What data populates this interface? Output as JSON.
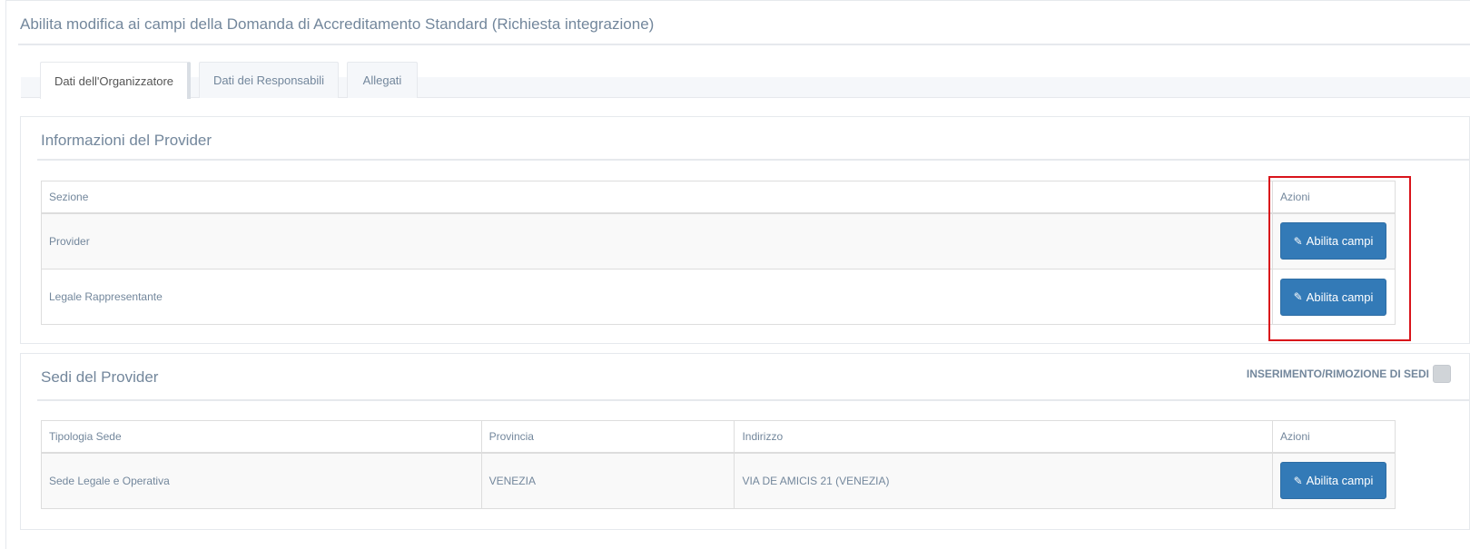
{
  "page": {
    "title": "Abilita modifica ai campi della Domanda di Accreditamento Standard (Richiesta integrazione)"
  },
  "tabs": [
    {
      "label": "Dati dell'Organizzatore",
      "active": true
    },
    {
      "label": "Dati dei Responsabili",
      "active": false
    },
    {
      "label": "Allegati",
      "active": false
    }
  ],
  "provider_info": {
    "title": "Informazioni del Provider",
    "headers": {
      "section": "Sezione",
      "actions": "Azioni"
    },
    "rows": [
      {
        "section": "Provider",
        "action_label": "Abilita campi"
      },
      {
        "section": "Legale Rappresentante",
        "action_label": "Abilita campi"
      }
    ]
  },
  "sedi": {
    "title": "Sedi del Provider",
    "toggle_label": "INSERIMENTO/RIMOZIONE DI SEDI",
    "headers": {
      "tipologia": "Tipologia Sede",
      "provincia": "Provincia",
      "indirizzo": "Indirizzo",
      "actions": "Azioni"
    },
    "rows": [
      {
        "tipologia": "Sede Legale e Operativa",
        "provincia": "VENEZIA",
        "indirizzo": "VIA DE AMICIS 21 (VENEZIA)",
        "action_label": "Abilita campi"
      }
    ]
  },
  "icons": {
    "edit": "pencil-icon"
  },
  "colors": {
    "button": "#337ab7",
    "highlight": "#d9141b",
    "text": "#73879c"
  }
}
